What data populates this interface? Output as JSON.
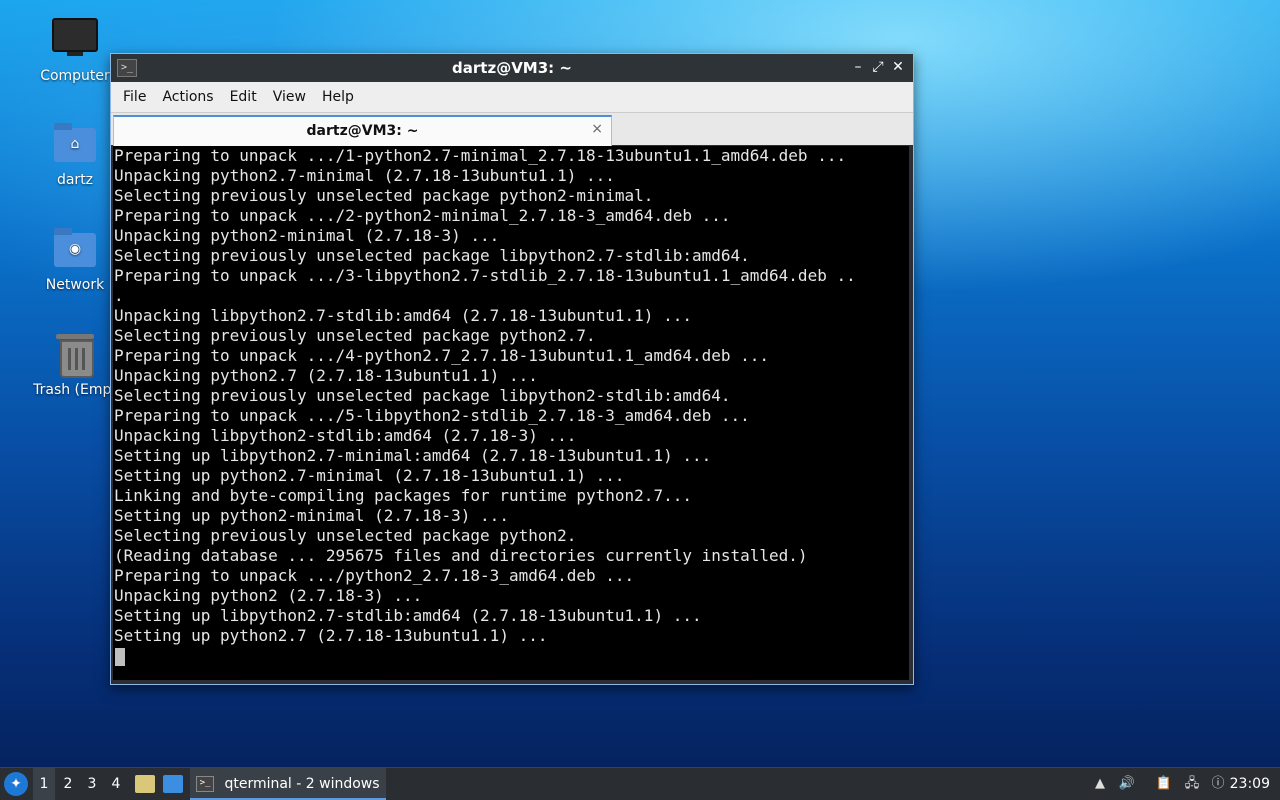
{
  "desktop": {
    "icons": [
      {
        "label": "Computer",
        "icon": "computer-icon"
      },
      {
        "label": "dartz",
        "icon": "home-folder-icon"
      },
      {
        "label": "Network",
        "icon": "network-folder-icon"
      },
      {
        "label": "Trash (Empt",
        "icon": "trash-icon"
      }
    ]
  },
  "window": {
    "title": "dartz@VM3: ~",
    "menu": [
      "File",
      "Actions",
      "Edit",
      "View",
      "Help"
    ],
    "tab_label": "dartz@VM3: ~",
    "tab_close": "×",
    "buttons": {
      "minimize": "–",
      "maximize": "⤢",
      "close": "✕"
    }
  },
  "terminal": {
    "lines": [
      "Preparing to unpack .../1-python2.7-minimal_2.7.18-13ubuntu1.1_amd64.deb ...",
      "Unpacking python2.7-minimal (2.7.18-13ubuntu1.1) ...",
      "Selecting previously unselected package python2-minimal.",
      "Preparing to unpack .../2-python2-minimal_2.7.18-3_amd64.deb ...",
      "Unpacking python2-minimal (2.7.18-3) ...",
      "Selecting previously unselected package libpython2.7-stdlib:amd64.",
      "Preparing to unpack .../3-libpython2.7-stdlib_2.7.18-13ubuntu1.1_amd64.deb ..",
      ".",
      "Unpacking libpython2.7-stdlib:amd64 (2.7.18-13ubuntu1.1) ...",
      "Selecting previously unselected package python2.7.",
      "Preparing to unpack .../4-python2.7_2.7.18-13ubuntu1.1_amd64.deb ...",
      "Unpacking python2.7 (2.7.18-13ubuntu1.1) ...",
      "Selecting previously unselected package libpython2-stdlib:amd64.",
      "Preparing to unpack .../5-libpython2-stdlib_2.7.18-3_amd64.deb ...",
      "Unpacking libpython2-stdlib:amd64 (2.7.18-3) ...",
      "Setting up libpython2.7-minimal:amd64 (2.7.18-13ubuntu1.1) ...",
      "Setting up python2.7-minimal (2.7.18-13ubuntu1.1) ...",
      "Linking and byte-compiling packages for runtime python2.7...",
      "Setting up python2-minimal (2.7.18-3) ...",
      "Selecting previously unselected package python2.",
      "(Reading database ... 295675 files and directories currently installed.)",
      "Preparing to unpack .../python2_2.7.18-3_amd64.deb ...",
      "Unpacking python2 (2.7.18-3) ...",
      "Setting up libpython2.7-stdlib:amd64 (2.7.18-13ubuntu1.1) ...",
      "Setting up python2.7 (2.7.18-13ubuntu1.1) ..."
    ]
  },
  "taskbar": {
    "workspaces": [
      "1",
      "2",
      "3",
      "4"
    ],
    "active_workspace": "1",
    "task_label": "qterminal - 2 windows",
    "clock": "23:09"
  },
  "colors": {
    "accent": "#4c8fd6",
    "terminal_bg": "#000000",
    "terminal_fg": "#e6e6e6",
    "taskbar_bg": "#2a2e33"
  }
}
